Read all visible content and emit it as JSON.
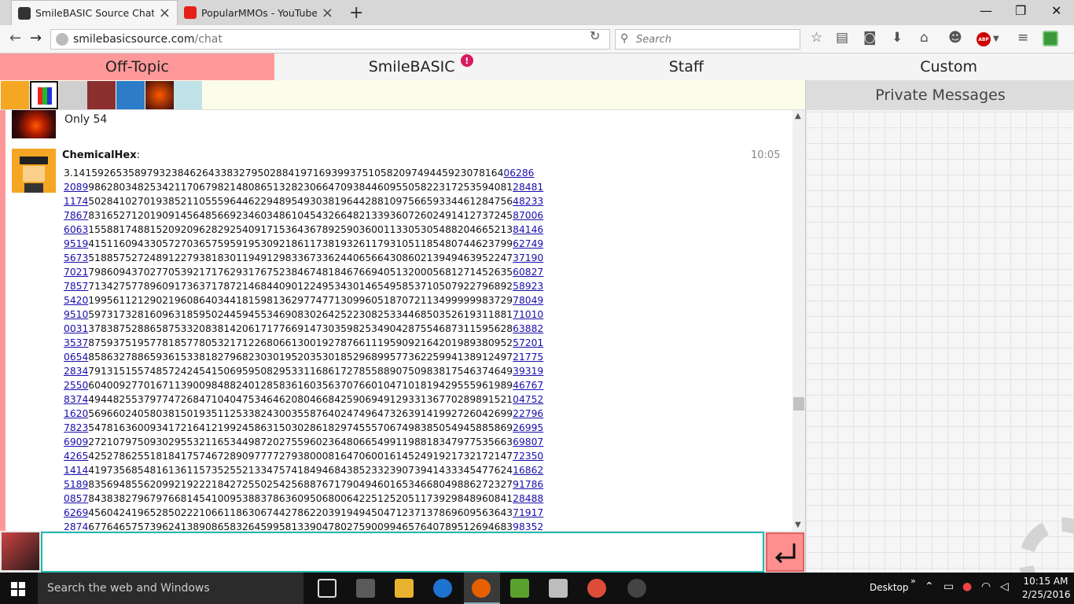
{
  "browser": {
    "tabs": [
      {
        "title": "SmileBASIC Source Chat",
        "active": true
      },
      {
        "title": "PopularMMOs - YouTube",
        "active": false
      }
    ],
    "url_host": "smilebasicsource.com",
    "url_path": "/chat",
    "search_placeholder": "Search",
    "abp_label": "ABP"
  },
  "chat": {
    "tabs": [
      "Off-Topic",
      "SmileBASIC",
      "Staff",
      "Custom"
    ],
    "active_tab": "Off-Topic",
    "smilebasic_badge": "!",
    "online_users_count": 7,
    "private_messages_title": "Private Messages",
    "messages": [
      {
        "author": "",
        "text": "Only 54"
      },
      {
        "author": "ChemicalHex",
        "time": "10:05",
        "pi_first": "3.1415926535897932384626433832795028841971693993751058209749445923078164",
        "pi_first_link": "06286",
        "rows": [
          {
            "link_start": "2089",
            "text": "986280348253421170679821480865132823066470938446095505822317253594081",
            "link_end": "28481"
          },
          {
            "link_start": "1174",
            "text": "502841027019385211055596446229489549303819644288109756659334461284756",
            "link_end": "48233"
          },
          {
            "link_start": "7867",
            "text": "831652712019091456485669234603486104543266482133936072602491412737245",
            "link_end": "87006"
          },
          {
            "link_start": "6063",
            "text": "155881748815209209628292540917153643678925903600113305305488204665213",
            "link_end": "84146"
          },
          {
            "link_start": "9519",
            "text": "415116094330572703657595919530921861173819326117931051185480744623799",
            "link_end": "62749"
          },
          {
            "link_start": "5673",
            "text": "518857527248912279381830119491298336733624406566430860213949463952247",
            "link_end": "37190"
          },
          {
            "link_start": "7021",
            "text": "798609437027705392171762931767523846748184676694051320005681271452635",
            "link_end": "60827"
          },
          {
            "link_start": "7857",
            "text": "713427577896091736371787214684409012249534301465495853710507922796892",
            "link_end": "58923"
          },
          {
            "link_start": "5420",
            "text": "199561121290219608640344181598136297747713099605187072113499999983729",
            "link_end": "78049"
          },
          {
            "link_start": "9510",
            "text": "597317328160963185950244594553469083026425223082533446850352619311881",
            "link_end": "71010"
          },
          {
            "link_start": "0031",
            "text": "378387528865875332083814206171776691473035982534904287554687311595628",
            "link_end": "63882"
          },
          {
            "link_start": "3537",
            "text": "875937519577818577805321712268066130019278766111959092164201989380952",
            "link_end": "57201"
          },
          {
            "link_start": "0654",
            "text": "858632788659361533818279682303019520353018529689957736225994138912497",
            "link_end": "21775"
          },
          {
            "link_start": "2834",
            "text": "791315155748572424541506959508295331168617278558890750983817546374649",
            "link_end": "39319"
          },
          {
            "link_start": "2550",
            "text": "604009277016711390098488240128583616035637076601047101819429555961989",
            "link_end": "46767"
          },
          {
            "link_start": "8374",
            "text": "494482553797747268471040475346462080466842590694912933136770289891521",
            "link_end": "04752"
          },
          {
            "link_start": "1620",
            "text": "569660240580381501935112533824300355876402474964732639141992726042699",
            "link_end": "22796"
          },
          {
            "link_start": "7823",
            "text": "547816360093417216412199245863150302861829745557067498385054945885869",
            "link_end": "26995"
          },
          {
            "link_start": "6909",
            "text": "272107975093029553211653449872027559602364806654991198818347977535663",
            "link_end": "69807"
          },
          {
            "link_start": "4265",
            "text": "425278625518184175746728909777727938000816470600161452491921732172147",
            "link_end": "72350"
          },
          {
            "link_start": "1414",
            "text": "419735685481613611573525521334757418494684385233239073941433345477624",
            "link_end": "16862"
          },
          {
            "link_start": "5189",
            "text": "835694855620992192221842725502542568876717904946016534668049886272327",
            "link_end": "91786"
          },
          {
            "link_start": "0857",
            "text": "843838279679766814541009538837863609506800642251252051173929848960841",
            "link_end": "28488"
          },
          {
            "link_start": "6269",
            "text": "456042419652850222106611863067442786220391949450471237137869609563643",
            "link_end": "71917"
          },
          {
            "link_start": "2874",
            "text": "677646575739624138908658326459958133904780275900994657640789512694683",
            "link_end": "98352"
          }
        ]
      }
    ]
  },
  "taskbar": {
    "search_placeholder": "Search the web and Windows",
    "desktop_label": "Desktop",
    "time": "10:15 AM",
    "date": "2/25/2016"
  }
}
